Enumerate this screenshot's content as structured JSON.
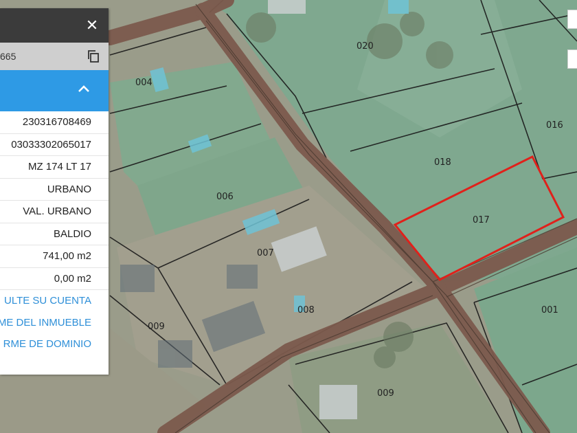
{
  "panel": {
    "close_label": "✕",
    "parcel_id": "665",
    "rows": [
      "230316708469",
      "03033302065017",
      "MZ 174 LT 17",
      "URBANO",
      "VAL. URBANO",
      "BALDIO",
      "741,00 m2",
      "0,00 m2"
    ],
    "links": [
      "ULTE SU CUENTA",
      "ME DEL INMUEBLE",
      "RME DE DOMINIO"
    ]
  },
  "map": {
    "parcels": [
      "004",
      "020",
      "016",
      "018",
      "006",
      "017",
      "007",
      "008",
      "009",
      "001",
      "009"
    ],
    "highlight_color": "#e0211b"
  }
}
